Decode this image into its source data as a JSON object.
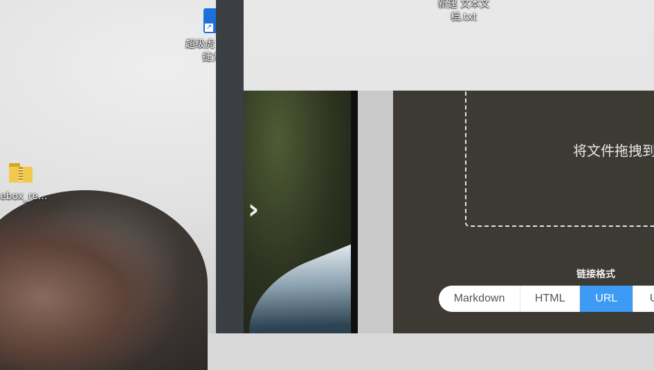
{
  "desktop": {
    "icons": [
      {
        "label_line1": "超级虎",
        "label_line2": "捷方"
      },
      {
        "label": "ebox_re..."
      },
      {
        "label": "..."
      },
      {
        "label_line1": "新建 文本文",
        "label_line2": "档.txt"
      }
    ]
  },
  "panel": {
    "drop_text": "将文件拖拽到",
    "format_label": "链接格式",
    "formats": [
      "Markdown",
      "HTML",
      "URL",
      "U"
    ],
    "active_format": "URL",
    "accent_color": "#3d9bf5"
  }
}
